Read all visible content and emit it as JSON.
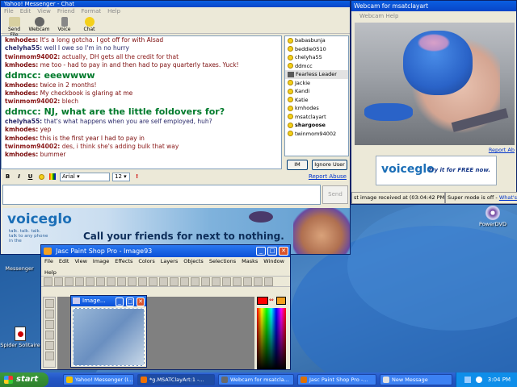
{
  "chat": {
    "title": "Yahoo! Messenger - Chat",
    "menu": [
      "File",
      "Edit",
      "View",
      "Friend",
      "Format",
      "Help"
    ],
    "toolbar": [
      "Send File",
      "Webcam",
      "Voice",
      "Chat"
    ],
    "messages": [
      {
        "name": "kmhodes:",
        "text": "It's a long gotcha. I got off for with Alsad",
        "cls": "c-kd"
      },
      {
        "name": "chelyha55:",
        "text": "well I owe so I'm in no hurry",
        "cls": "c-ch"
      },
      {
        "name": "twinmom94002:",
        "text": "actually, DH gets all the credit for that",
        "cls": "c-tw"
      },
      {
        "name": "kmhodes:",
        "text": "me too - had to pay in and then had to pay quarterly taxes. Yuck!",
        "cls": "c-kd"
      },
      {
        "name": "ddmcc:",
        "text": "eeewwww",
        "cls": "c-dd",
        "big": true
      },
      {
        "name": "kmhodes:",
        "text": "twice in 2 months!",
        "cls": "c-kd"
      },
      {
        "name": "kmhodes:",
        "text": "My checkbook is glaring at me",
        "cls": "c-kd"
      },
      {
        "name": "twinmom94002:",
        "text": "blech",
        "cls": "c-tw"
      },
      {
        "name": "ddmcc:",
        "text": "NJ, what are the little foldovers for?",
        "cls": "c-dd",
        "big": true
      },
      {
        "name": "chelyha55:",
        "text": "that's what happens when you are self employed, huh?",
        "cls": "c-ch"
      },
      {
        "name": "kmhodes:",
        "text": "yep",
        "cls": "c-kd"
      },
      {
        "name": "kmhodes:",
        "text": "this is the first year I had to pay in",
        "cls": "c-kd"
      },
      {
        "name": "twinmom94002:",
        "text": "des, i think she's adding bulk that way",
        "cls": "c-tw"
      },
      {
        "name": "kmhodes:",
        "text": "bummer",
        "cls": "c-kd"
      }
    ],
    "buddies": [
      {
        "name": "babasbunja",
        "icon": "smiley"
      },
      {
        "name": "beddie0510",
        "icon": "smiley"
      },
      {
        "name": "chelyha55",
        "icon": "smiley"
      },
      {
        "name": "ddmcc",
        "icon": "smiley"
      },
      {
        "name": "Fearless Leader",
        "icon": "cam",
        "selected": true
      },
      {
        "name": "Jackie",
        "icon": "smiley"
      },
      {
        "name": "Kandi",
        "icon": "smiley"
      },
      {
        "name": "Katie",
        "icon": "smiley"
      },
      {
        "name": "kmhodes",
        "icon": "smiley"
      },
      {
        "name": "msatclayart",
        "icon": "smiley"
      },
      {
        "name": "shargoose",
        "icon": "smiley",
        "bold": true
      },
      {
        "name": "twinmom94002",
        "icon": "smiley"
      }
    ],
    "im_label": "IM",
    "ignore_label": "Ignore User",
    "font": "Arial",
    "size": "12",
    "report_abuse": "Report Abuse",
    "send": "Send",
    "ad_logo": "voiceglo",
    "ad_tag": "talk. talk. talk. talk to any phone in the",
    "ad_slogan": "Call your friends for next to nothing."
  },
  "webcam": {
    "title": "Webcam for msatclayart",
    "menu": "Webcam  Help",
    "report": "Report Ab",
    "ad_logo": "voiceglo",
    "ad_try": "Try it for FREE now.",
    "status_left": "st image received at (03:04:42 PM)",
    "status_right": "Super mode is off - ",
    "status_link": "What's th"
  },
  "psp": {
    "title": "Jasc Paint Shop Pro - Image93",
    "menu": [
      "File",
      "Edit",
      "View",
      "Image",
      "Effects",
      "Colors",
      "Layers",
      "Objects",
      "Selections",
      "Masks",
      "Window"
    ],
    "menu2": "Help",
    "image_title": "Image..."
  },
  "desktop": {
    "powerdvd": "PowerDVD",
    "messenger": "Messenger",
    "spider": "Spider Solitaire"
  },
  "taskbar": {
    "start": "start",
    "tasks": [
      {
        "label": "Yahoo! Messenger (I...",
        "color": "#f0c000"
      },
      {
        "label": "*g.MSATClayArt:1 -...",
        "color": "#f07000",
        "active": true
      },
      {
        "label": "Webcam for msatcla...",
        "color": "#6a6a6a"
      },
      {
        "label": "Jasc Paint Shop Pro -...",
        "color": "#e07000"
      },
      {
        "label": "New Message",
        "color": "#e0e0e0"
      }
    ],
    "time": "3:04 PM"
  }
}
